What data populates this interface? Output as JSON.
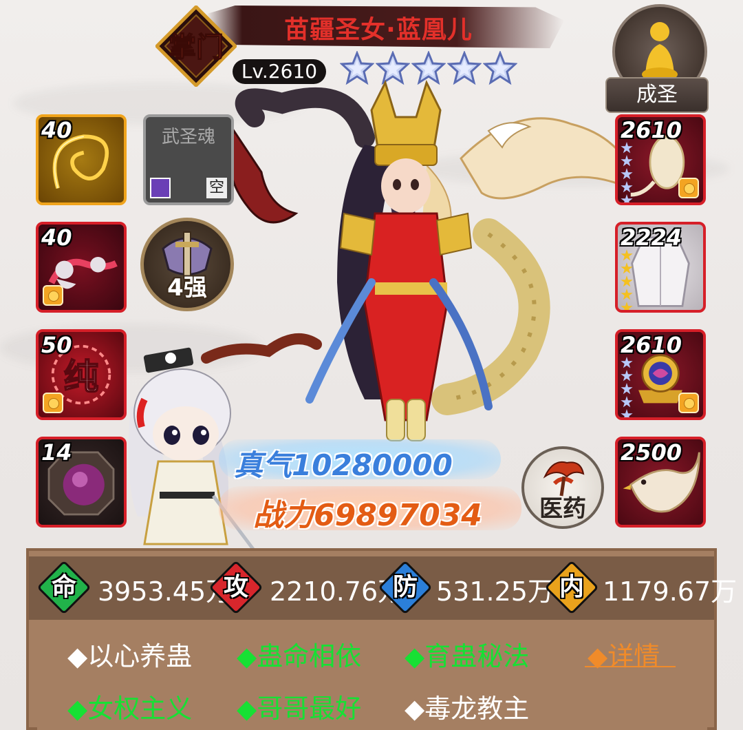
{
  "header": {
    "hero_name": "苗疆圣女·蓝凰儿",
    "level": "Lv.2610",
    "rank_badge": "掌门",
    "star_count": 5,
    "title": "成圣"
  },
  "left_slots": [
    {
      "level": "40",
      "icon": "whip-icon"
    },
    {
      "level": "40",
      "icon": "ghost-spirit-icon"
    },
    {
      "level": "50",
      "icon": "pure-technique-icon"
    },
    {
      "level": "14",
      "icon": "purple-orb-icon"
    }
  ],
  "martial_soul": {
    "label": "武圣魂",
    "empty_tag": "空"
  },
  "strength": {
    "label": "4强"
  },
  "right_slots": [
    {
      "level": "2610",
      "icon": "egg-pet-icon"
    },
    {
      "level": "2224",
      "icon": "white-robe-icon"
    },
    {
      "level": "2610",
      "icon": "golden-orb-icon"
    },
    {
      "level": "2500",
      "icon": "phoenix-icon"
    }
  ],
  "qi": {
    "text": "真气10280000"
  },
  "power": {
    "text": "战力69897034"
  },
  "medicine": {
    "label": "医药"
  },
  "attributes": [
    {
      "icon_char": "命",
      "color": "#21b24a",
      "value": "3953.45万"
    },
    {
      "icon_char": "攻",
      "color": "#d8262c",
      "value": "2210.76万"
    },
    {
      "icon_char": "防",
      "color": "#2b7fd9",
      "value": "531.25万"
    },
    {
      "icon_char": "内",
      "color": "#e9a21c",
      "value": "1179.67万"
    }
  ],
  "skills": [
    {
      "text": "◆以心养蛊",
      "color": "white"
    },
    {
      "text": "◆蛊命相依",
      "color": "green"
    },
    {
      "text": "◆育蛊秘法",
      "color": "green"
    },
    {
      "text": "◆详情",
      "color": "orange"
    },
    {
      "text": "◆女权主义",
      "color": "green"
    },
    {
      "text": "◆哥哥最好",
      "color": "green"
    },
    {
      "text": "◆毒龙教主",
      "color": "white"
    }
  ],
  "colors": {
    "slot_gold": "#f0a41c",
    "slot_red": "#d61f28",
    "panel": "#a57f62",
    "skill_green": "#17e034"
  }
}
